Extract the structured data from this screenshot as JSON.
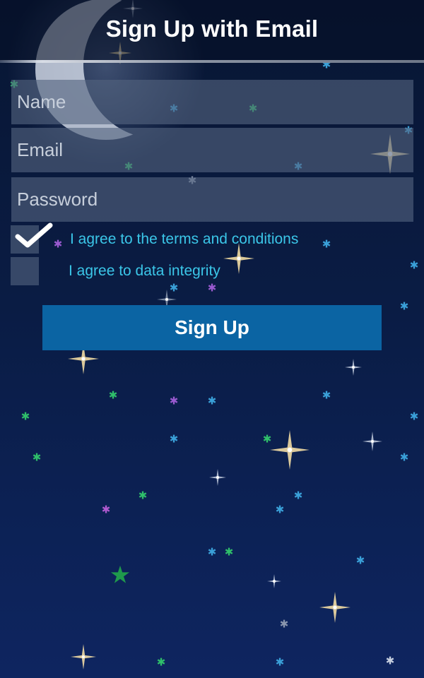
{
  "header": {
    "title": "Sign Up with Email"
  },
  "form": {
    "name": {
      "placeholder": "Name",
      "value": ""
    },
    "email": {
      "placeholder": "Email",
      "value": ""
    },
    "password": {
      "placeholder": "Password",
      "value": ""
    }
  },
  "agreements": [
    {
      "label": "I agree to the terms and conditions",
      "checked": true
    },
    {
      "label": "I agree to data integrity",
      "checked": false
    }
  ],
  "actions": {
    "signup_label": "Sign Up"
  },
  "theme": {
    "background_top": "#081633",
    "background_bottom": "#0e2560",
    "field_fill": "#54647f",
    "label_color": "#3bc6e8",
    "button_color": "#0b64a3",
    "icons": [
      "moon-icon",
      "star-icons",
      "checkmark-icon"
    ]
  }
}
